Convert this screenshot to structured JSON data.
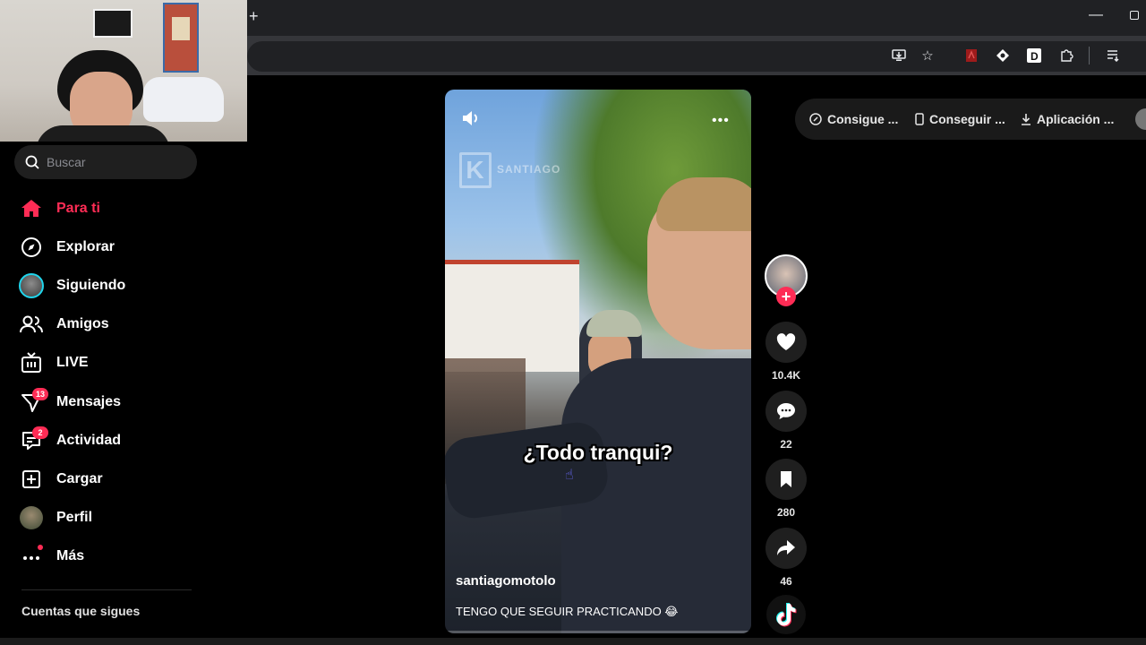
{
  "browser": {
    "new_tab_icon": "plus-icon",
    "toolbar_icons": [
      "install-app-icon",
      "bookmark-star-icon",
      "pdf-extension-icon",
      "extension-diamond-icon",
      "extension-d-icon",
      "extensions-puzzle-icon",
      "reading-list-icon"
    ]
  },
  "sidebar": {
    "search": {
      "placeholder": "Buscar"
    },
    "items": [
      {
        "label": "Para ti",
        "icon": "home-icon",
        "active": true
      },
      {
        "label": "Explorar",
        "icon": "compass-icon"
      },
      {
        "label": "Siguiendo",
        "icon": "following-avatar-icon"
      },
      {
        "label": "Amigos",
        "icon": "friends-icon"
      },
      {
        "label": "LIVE",
        "icon": "live-tv-icon"
      },
      {
        "label": "Mensajes",
        "icon": "messages-icon",
        "badge": "13"
      },
      {
        "label": "Actividad",
        "icon": "activity-icon",
        "badge": "2"
      },
      {
        "label": "Cargar",
        "icon": "upload-icon"
      },
      {
        "label": "Perfil",
        "icon": "profile-avatar-icon"
      },
      {
        "label": "Más",
        "icon": "more-dots-icon"
      }
    ],
    "following_title": "Cuentas que sigues"
  },
  "video": {
    "watermark": "SANTIAGO",
    "caption_overlay": "¿Todo tranqui?",
    "username": "santiagomotolo",
    "description": "TENGO QUE SEGUIR PRACTICANDO 😂"
  },
  "actions": {
    "likes": "10.4K",
    "comments": "22",
    "saves": "280",
    "shares": "46"
  },
  "top_bar": {
    "items": [
      {
        "label": "Consigue ...",
        "icon": "coin-icon"
      },
      {
        "label": "Conseguir ...",
        "icon": "phone-icon"
      },
      {
        "label": "Aplicación ...",
        "icon": "download-icon"
      }
    ]
  },
  "colors": {
    "accent": "#fe2c55",
    "background": "#000000",
    "surface": "#1f1f1f"
  }
}
